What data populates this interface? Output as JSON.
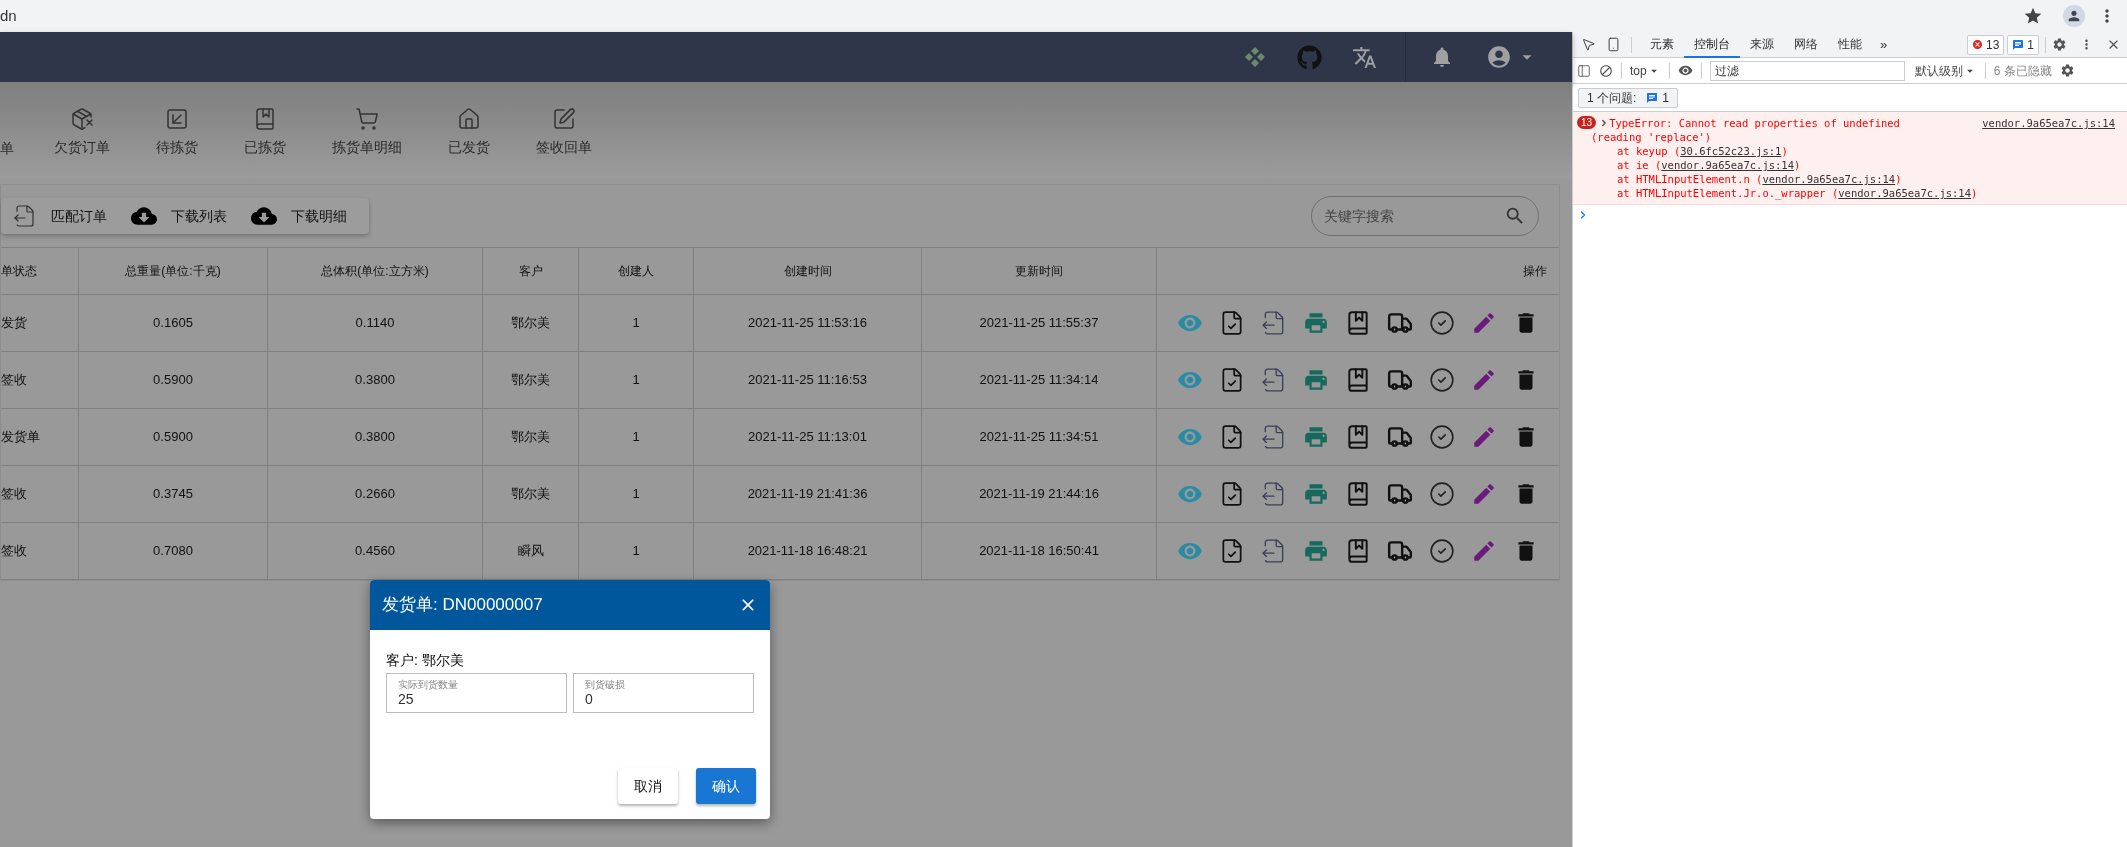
{
  "browser": {
    "address": "dn"
  },
  "nav": [
    {
      "label": "单"
    },
    {
      "label": "欠货订单"
    },
    {
      "label": "待拣货"
    },
    {
      "label": "已拣货"
    },
    {
      "label": "拣货单明细"
    },
    {
      "label": "已发货"
    },
    {
      "label": "签收回单"
    }
  ],
  "toolbar_buttons": [
    "匹配订单",
    "下载列表",
    "下载明细"
  ],
  "search": {
    "placeholder": "关键字搜索"
  },
  "table": {
    "columns": [
      "单状态",
      "总重量(单位:千克)",
      "总体积(单位:立方米)",
      "客户",
      "创建人",
      "创建时间",
      "更新时间",
      "操作"
    ],
    "rows": [
      {
        "cells": [
          "发货",
          "0.1605",
          "0.1140",
          "鄂尔美",
          "1",
          "2021-11-25 11:53:16",
          "2021-11-25 11:55:37"
        ]
      },
      {
        "cells": [
          "签收",
          "0.5900",
          "0.3800",
          "鄂尔美",
          "1",
          "2021-11-25 11:16:53",
          "2021-11-25 11:34:14"
        ]
      },
      {
        "cells": [
          "发货单",
          "0.5900",
          "0.3800",
          "鄂尔美",
          "1",
          "2021-11-25 11:13:01",
          "2021-11-25 11:34:51"
        ]
      },
      {
        "cells": [
          "签收",
          "0.3745",
          "0.2660",
          "鄂尔美",
          "1",
          "2021-11-19 21:41:36",
          "2021-11-19 21:44:16"
        ]
      },
      {
        "cells": [
          "签收",
          "0.7080",
          "0.4560",
          "瞬风",
          "1",
          "2021-11-18 16:48:21",
          "2021-11-18 16:50:41"
        ]
      }
    ]
  },
  "dialog": {
    "title": "发货单: DN00000007",
    "customer": "客户: 鄂尔美",
    "fields": [
      {
        "label": "实际到货数量",
        "value": "25"
      },
      {
        "label": "到货破损",
        "value": "0"
      }
    ],
    "buttons": [
      {
        "label": "取消",
        "kind": "secondary"
      },
      {
        "label": "确认",
        "kind": "primary"
      }
    ]
  },
  "devtools": {
    "tabs": [
      {
        "label": "元素",
        "selected": false
      },
      {
        "label": "控制台",
        "selected": true
      },
      {
        "label": "来源",
        "selected": false
      },
      {
        "label": "网络",
        "selected": false
      },
      {
        "label": "性能",
        "selected": false
      }
    ],
    "more": "»",
    "error_count": "13",
    "message_count": "1",
    "context": "top",
    "filter_placeholder": "过滤",
    "level": "默认级别",
    "hidden": "6 条已隐藏",
    "issues": {
      "label": "1 个问题:",
      "count": "1"
    },
    "error": {
      "count": "13",
      "lines": [
        "TypeError: Cannot read properties of undefined",
        "(reading 'replace')"
      ],
      "source": "vendor.9a65ea7c.js:14",
      "stack": [
        {
          "call": "at keyup (",
          "link": "30.6fc52c23.js:1",
          "close": ")"
        },
        {
          "call": "at ie (",
          "link": "vendor.9a65ea7c.js:14",
          "close": ")"
        },
        {
          "call": "at HTMLInputElement.n (",
          "link": "vendor.9a65ea7c.js:14",
          "close": ")"
        },
        {
          "call": "at HTMLInputElement.Jr.o._wrapper (",
          "link": "vendor.9a65ea7c.js:14",
          "close": ")"
        }
      ]
    }
  }
}
